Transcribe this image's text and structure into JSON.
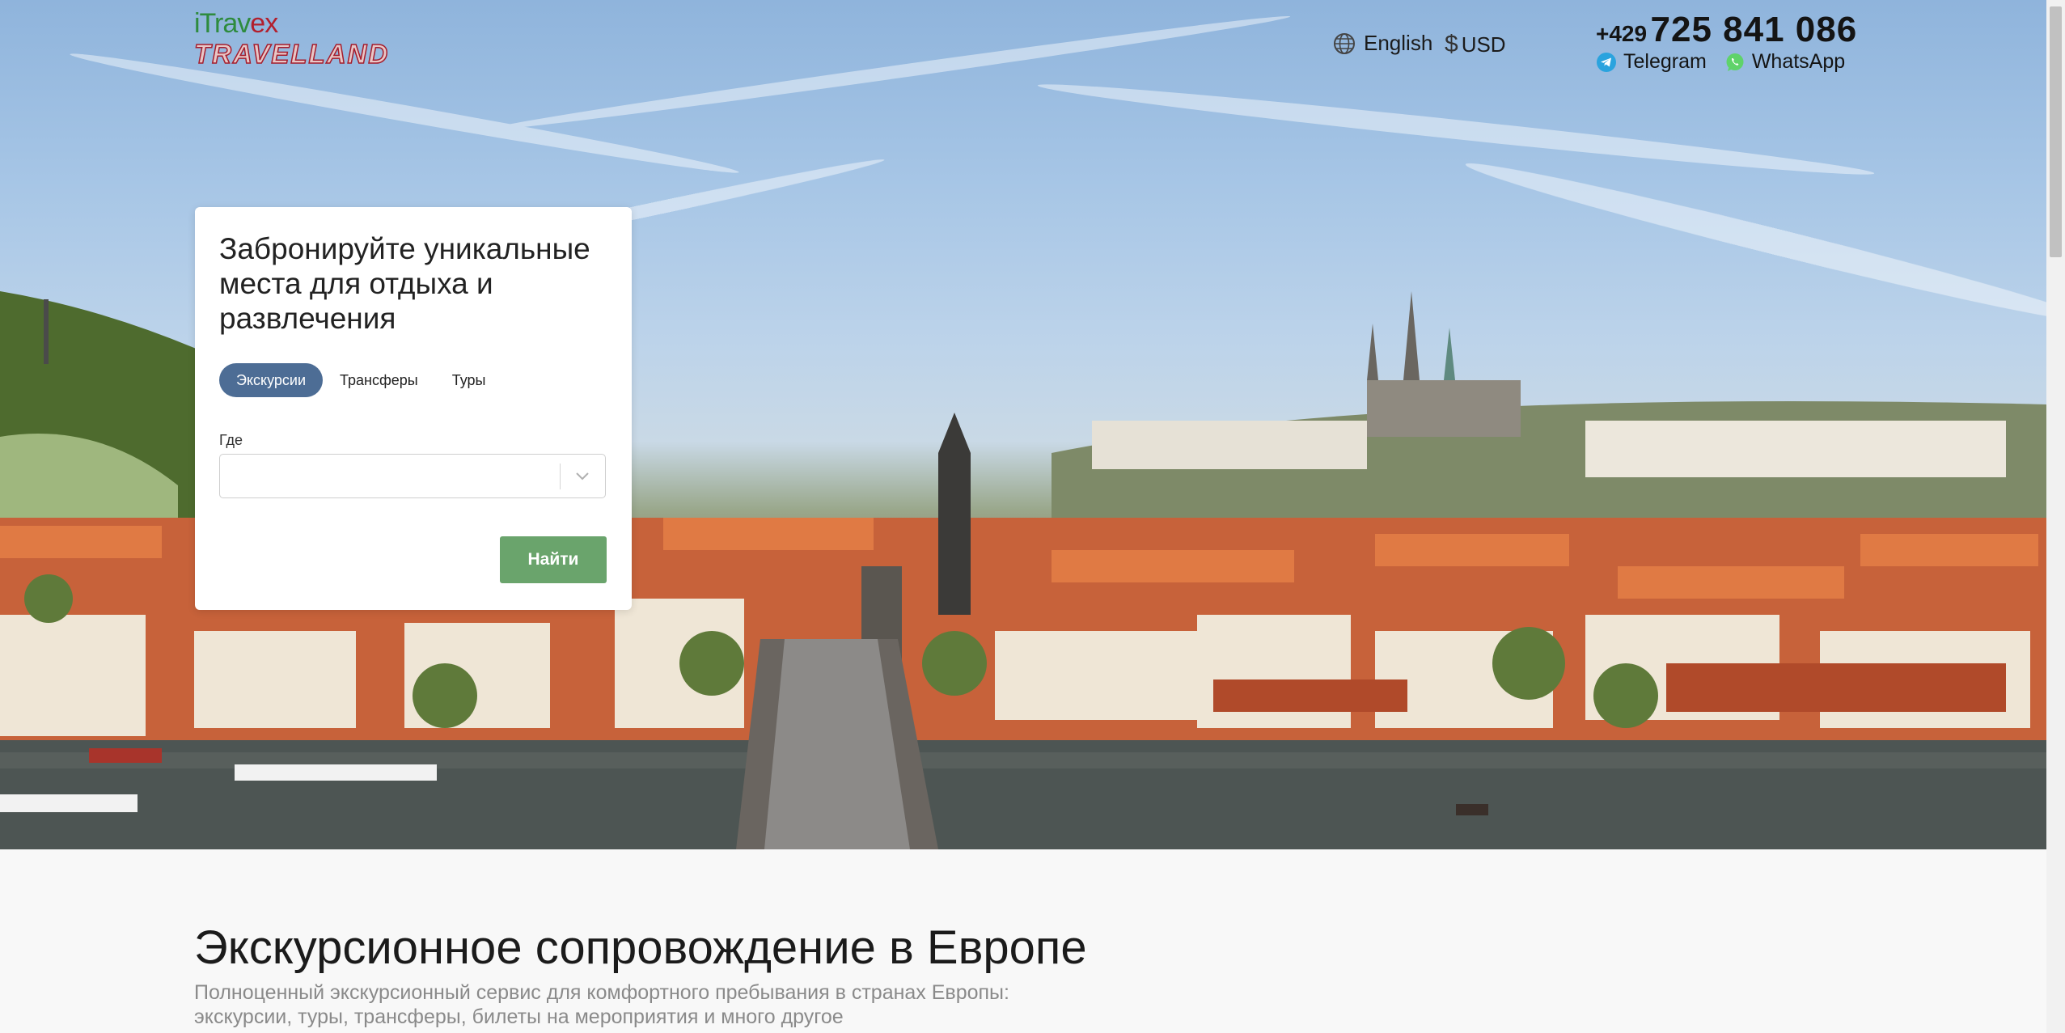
{
  "header": {
    "logo_top_main": "iTrav",
    "logo_top_accent": "ex",
    "logo_bottom": "TRAVELLAND",
    "language": "English",
    "currency_symbol": "$",
    "currency": "USD",
    "phone_code": "+429",
    "phone_number": "725 841 086",
    "telegram": "Telegram",
    "whatsapp": "WhatsApp"
  },
  "search": {
    "title": "Забронируйте уникальные места для отдыха и развлечения",
    "tabs": [
      {
        "label": "Экскурсии",
        "active": true
      },
      {
        "label": "Трансферы",
        "active": false
      },
      {
        "label": "Туры",
        "active": false
      }
    ],
    "where_label": "Где",
    "where_value": "",
    "find_button": "Найти"
  },
  "section": {
    "title": "Экскурсионное сопровождение в Европе",
    "subtitle_line1": "Полноценный экскурсионный сервис для комфортного пребывания в странах Европы:",
    "subtitle_line2": "экскурсии, туры, трансферы, билеты на мероприятия и много другое"
  },
  "colors": {
    "active_tab": "#4d6d95",
    "find_button": "#6aa46c",
    "logo_green": "#2e8b3e",
    "logo_red": "#a51d2d"
  }
}
